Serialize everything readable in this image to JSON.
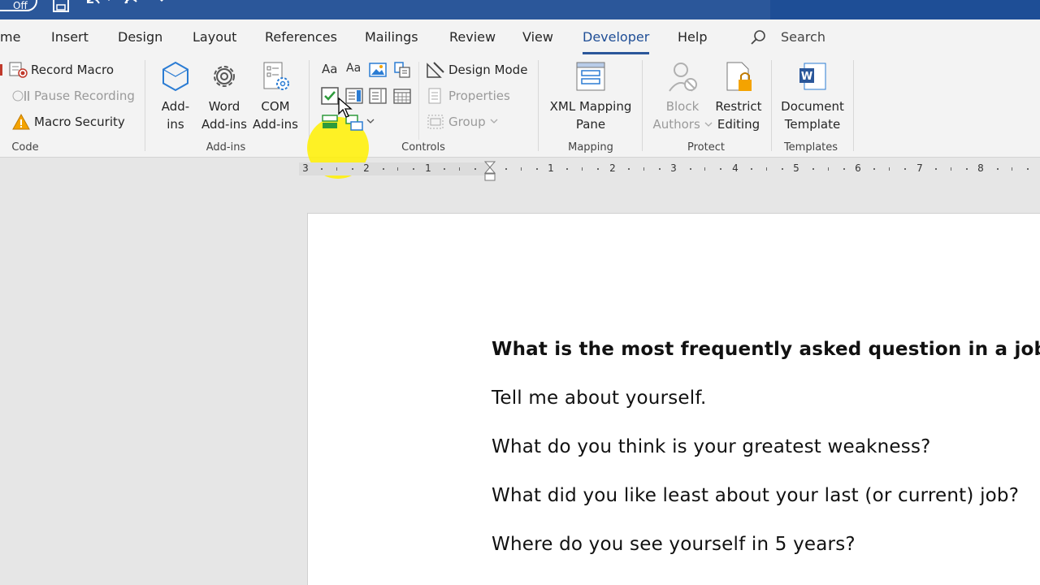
{
  "titlebar": {
    "autosave_state": "Off"
  },
  "tabs": [
    {
      "label": "me"
    },
    {
      "label": "Insert"
    },
    {
      "label": "Design"
    },
    {
      "label": "Layout"
    },
    {
      "label": "References"
    },
    {
      "label": "Mailings"
    },
    {
      "label": "Review"
    },
    {
      "label": "View"
    },
    {
      "label": "Developer"
    },
    {
      "label": "Help"
    }
  ],
  "search": {
    "label": "Search"
  },
  "ribbon": {
    "code": {
      "label": "Code",
      "record_macro": "Record Macro",
      "pause_recording": "Pause Recording",
      "macro_security": "Macro Security"
    },
    "addins": {
      "label": "Add-ins",
      "addins_btn": [
        "Add-",
        "ins"
      ],
      "word_addins": [
        "Word",
        "Add-ins"
      ],
      "com_addins": [
        "COM",
        "Add-ins"
      ]
    },
    "controls": {
      "label": "Controls",
      "design_mode": "Design Mode",
      "properties": "Properties",
      "group": "Group",
      "rich_text_glyph": "Aa",
      "plain_text_glyph": "Aa"
    },
    "mapping": {
      "label": "Mapping",
      "xml_pane": [
        "XML Mapping",
        "Pane"
      ]
    },
    "protect": {
      "label": "Protect",
      "block_authors": [
        "Block",
        "Authors"
      ],
      "restrict_editing": [
        "Restrict",
        "Editing"
      ]
    },
    "templates": {
      "label": "Templates",
      "document_template": [
        "Document",
        "Template"
      ]
    }
  },
  "ruler": {
    "left_numbers": [
      "3",
      "2",
      "1"
    ],
    "right_numbers": [
      "1",
      "2",
      "3",
      "4",
      "5",
      "6",
      "7",
      "8"
    ]
  },
  "document": {
    "lines": [
      "What is the most frequently asked question in a job inte",
      "Tell me about yourself.",
      "What do you think is your greatest weakness?",
      "What did you like least about your last (or current) job?",
      "Where do you see yourself in 5 years?"
    ]
  },
  "colors": {
    "titlebar": "#2b579a",
    "accent": "#2b579a",
    "highlight": "#fff000"
  }
}
